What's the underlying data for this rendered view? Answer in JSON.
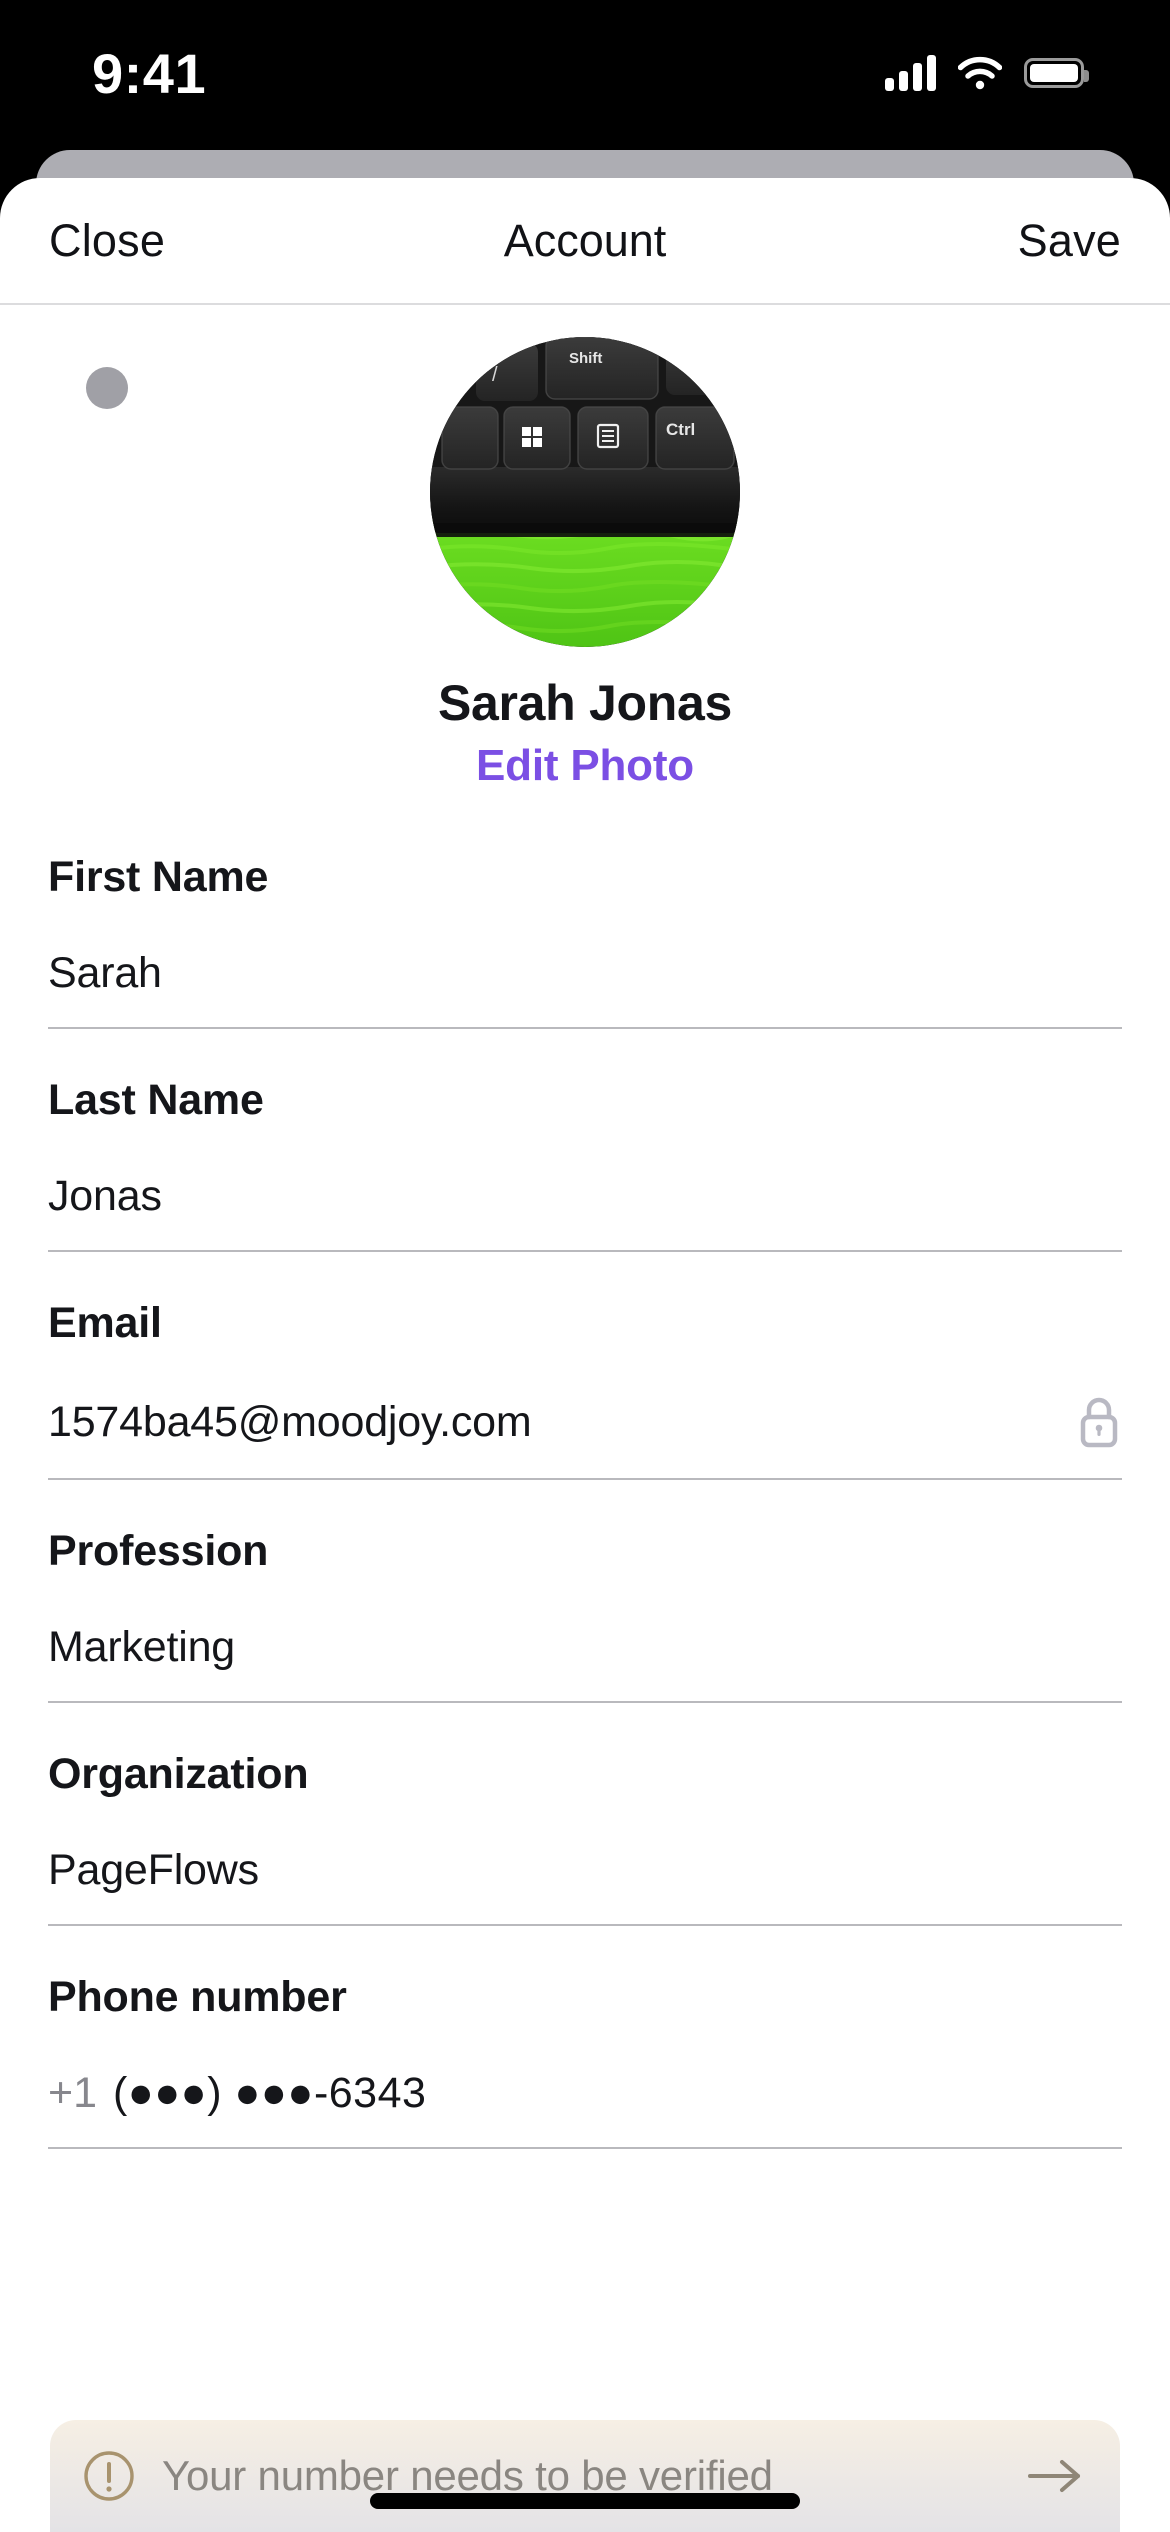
{
  "status_bar": {
    "time": "9:41",
    "cellular_icon": "cellular-bars-icon",
    "wifi_icon": "wifi-icon",
    "battery_icon": "battery-full-icon"
  },
  "navbar": {
    "close_label": "Close",
    "title": "Account",
    "save_label": "Save"
  },
  "profile": {
    "avatar_alt": "keyboard-on-green-cloth-photo",
    "name": "Sarah Jonas",
    "edit_photo_label": "Edit Photo",
    "accent_color": "#7B4FE4"
  },
  "form": {
    "fields": [
      {
        "label": "First Name",
        "value": "Sarah",
        "locked": false
      },
      {
        "label": "Last Name",
        "value": "Jonas",
        "locked": false
      },
      {
        "label": "Email",
        "value": "1574ba45@moodjoy.com",
        "locked": true
      },
      {
        "label": "Profession",
        "value": "Marketing",
        "locked": false
      },
      {
        "label": "Organization",
        "value": "PageFlows",
        "locked": false
      }
    ],
    "phone": {
      "label": "Phone number",
      "country_code": "+1",
      "number": "(●●●) ●●●-6343"
    }
  },
  "banner": {
    "icon": "warning-circle-icon",
    "message": "Your number needs to be verified",
    "action_icon": "arrow-right-icon",
    "background_color": "#F2ECE3",
    "text_color": "#8A8681"
  }
}
